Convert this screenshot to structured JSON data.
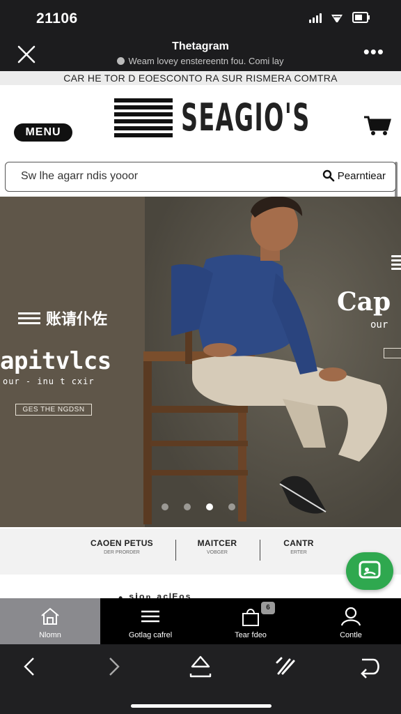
{
  "status_bar": {
    "time": "21106",
    "icons": [
      "signal-icon",
      "wifi-icon",
      "battery-icon"
    ]
  },
  "browser_header": {
    "title": "Thetagram",
    "url": "Weam lovey enstereentn fou. Comi lay",
    "close_icon": "close-icon",
    "more_icon": "more-icon",
    "more_label": "•••"
  },
  "promo_bar": {
    "text": "CAR HE TOR D EOESCONTO RA SUR RISMERA COMTRA"
  },
  "site_header": {
    "menu_label": "MENU",
    "logo_text": "SEAGIO'S",
    "cart_icon": "cart-icon"
  },
  "search": {
    "placeholder": "Sw lhe agarr ndis yooor",
    "button_label": "Pearntiear",
    "icon": "search-icon"
  },
  "hero": {
    "brand_mark": "账请仆佐",
    "headline": "apitvlcs",
    "subheadline": "our - inu t cxir",
    "cta_label": "GES THE NGDSN",
    "next_slide_headline": "Cap",
    "next_slide_sub": "our",
    "slides_total": 4,
    "active_slide": 2
  },
  "categories": [
    {
      "title": "CAOEN PETUS",
      "subtitle": "DER PRORDER"
    },
    {
      "title": "MAITCER",
      "subtitle": "VOBGER"
    },
    {
      "title": "CANTR",
      "subtitle": "ERTER"
    }
  ],
  "section_peek": "• ˢⁱᵒⁿ ᵃᶜˡᴱᵒˢ",
  "chat_button": {
    "icon": "chat-icon"
  },
  "tab_bar": {
    "tabs": [
      {
        "label": "Nlomn",
        "icon": "home-icon",
        "active": true
      },
      {
        "label": "Gotlag cafrel",
        "icon": "menu-icon",
        "active": false
      },
      {
        "label": "Tear fdeo",
        "icon": "bag-icon",
        "active": false,
        "badge": "6"
      },
      {
        "label": "Contle",
        "icon": "user-icon",
        "active": false
      }
    ]
  },
  "browser_toolbar": {
    "buttons": [
      "back-icon",
      "forward-icon",
      "share-icon",
      "edit-icon",
      "tabs-icon"
    ]
  },
  "colors": {
    "accent_green": "#2fa84f",
    "dark": "#1c1c1e",
    "hero_bg": "#5e564c",
    "shirt_blue": "#2e4a86"
  }
}
